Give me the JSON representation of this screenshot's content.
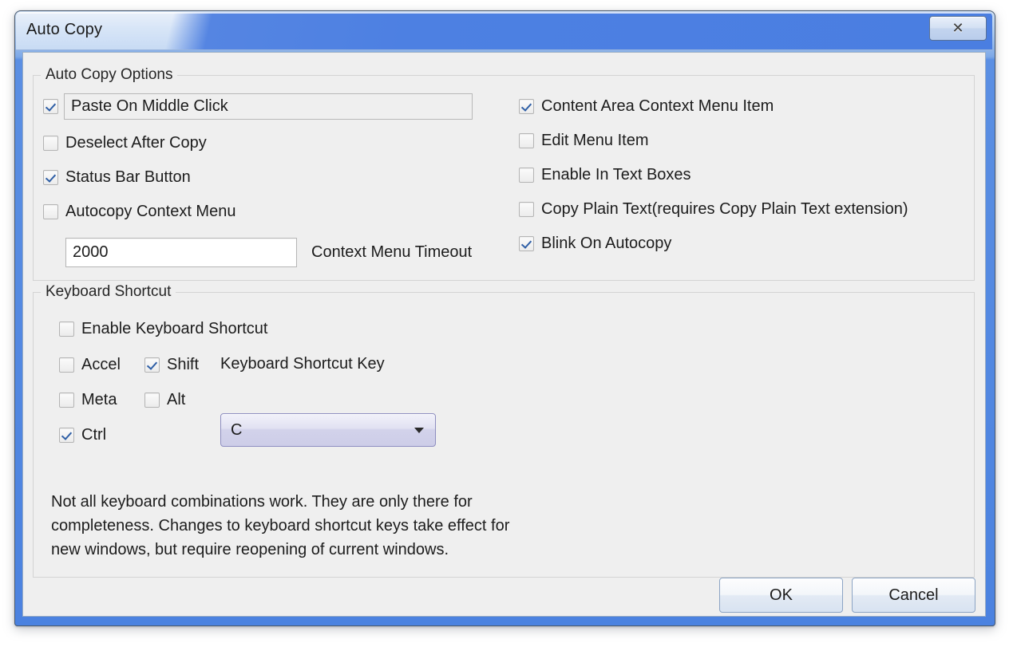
{
  "window": {
    "title": "Auto Copy",
    "close_icon": "close-icon",
    "close_glyph": "✕"
  },
  "options_group": {
    "legend": "Auto Copy Options",
    "left_column": [
      {
        "label": "Paste On Middle Click",
        "checked": true,
        "focused": true
      },
      {
        "label": "Deselect After Copy",
        "checked": false,
        "focused": false
      },
      {
        "label": "Status Bar Button",
        "checked": true,
        "focused": false
      },
      {
        "label": "Autocopy Context Menu",
        "checked": false,
        "focused": false
      }
    ],
    "right_column": [
      {
        "label": "Content Area Context Menu Item",
        "checked": true
      },
      {
        "label": "Edit Menu Item",
        "checked": false
      },
      {
        "label": "Enable In Text Boxes",
        "checked": false
      },
      {
        "label": "Copy Plain Text(requires Copy Plain Text extension)",
        "checked": false
      },
      {
        "label": "Blink On Autocopy",
        "checked": true
      }
    ],
    "timeout_value": "2000",
    "timeout_label": "Context Menu Timeout"
  },
  "shortcut_group": {
    "legend": "Keyboard Shortcut",
    "enable": {
      "label": "Enable Keyboard Shortcut",
      "checked": false
    },
    "modifiers": [
      {
        "label": "Accel",
        "checked": false
      },
      {
        "label": "Shift",
        "checked": true
      },
      {
        "label": "Meta",
        "checked": false
      },
      {
        "label": "Alt",
        "checked": false
      },
      {
        "label": "Ctrl",
        "checked": true
      }
    ],
    "key_label": "Keyboard Shortcut Key",
    "key_value": "C",
    "dropdown_icon": "chevron-down-icon",
    "note": "Not all keyboard combinations work. They are only there for completeness. Changes to keyboard shortcut keys take effect for new windows, but require reopening of current windows."
  },
  "buttons": {
    "ok": "OK",
    "cancel": "Cancel"
  },
  "colors": {
    "titlebar_blue": "#4a7ee1",
    "frame_blue": "#4b82e0",
    "client_background": "#efefef",
    "check_mark": "#2f5fa6",
    "combo_border": "#8e8ec0"
  }
}
